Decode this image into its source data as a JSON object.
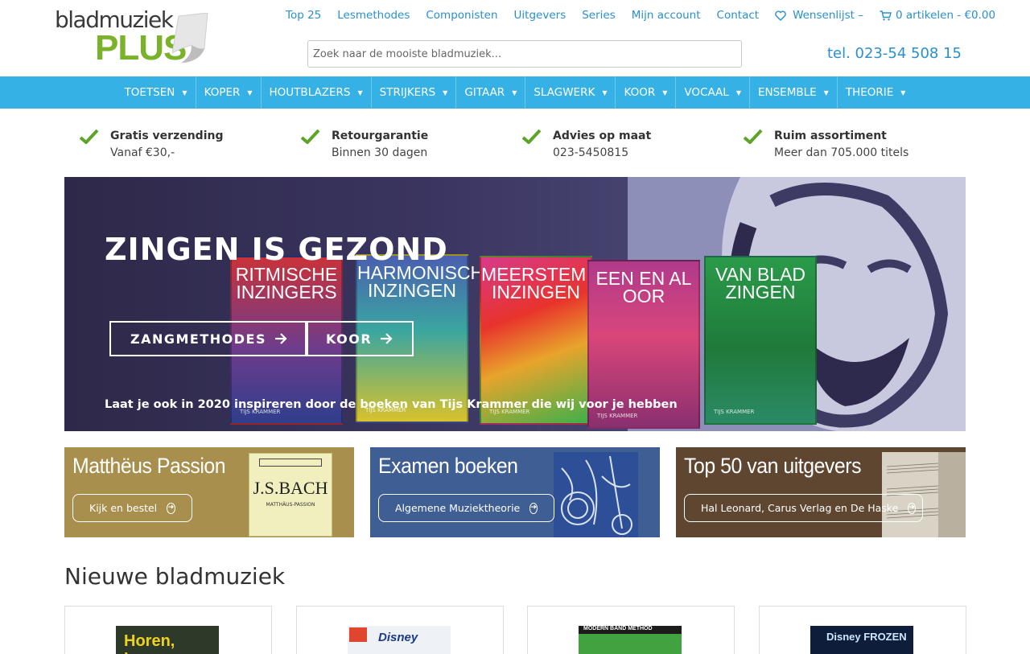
{
  "logo": {
    "top": "bladmuziek",
    "bottom": "PLUS"
  },
  "topnav": {
    "items": [
      "Top 25",
      "Lesmethodes",
      "Componisten",
      "Uitgevers",
      "Series",
      "Mijn account",
      "Contact"
    ],
    "wishlist": "Wensenlijst –",
    "cart": "0 artikelen - €0.00"
  },
  "search": {
    "placeholder": "Zoek naar de mooiste bladmuziek..."
  },
  "phone": "tel. 023-54 508 15",
  "categories": [
    "TOETSEN",
    "KOPER",
    "HOUTBLAZERS",
    "STRIJKERS",
    "GITAAR",
    "SLAGWERK",
    "KOOR",
    "VOCAAL",
    "ENSEMBLE",
    "THEORIE"
  ],
  "usps": [
    {
      "title": "Gratis verzending",
      "sub": "Vanaf €30,-"
    },
    {
      "title": "Retourgarantie",
      "sub": "Binnen 30 dagen"
    },
    {
      "title": "Advies op maat",
      "sub": "023-5450815"
    },
    {
      "title": "Ruim assortiment",
      "sub": "Meer dan 705.000 titels"
    }
  ],
  "hero": {
    "title": "ZINGEN IS GEZOND",
    "buttons": [
      "ZANGMETHODES",
      "KOOR"
    ],
    "tagline": "Laat je ook in 2020 inspireren door de boeken van Tijs Krammer die wij voor je hebben",
    "books": [
      {
        "title": "RITMISCHE INZINGERS",
        "author": "TIJS KRAMMER"
      },
      {
        "title": "HARMONISCH INZINGEN",
        "author": "TIJS KRAMMER"
      },
      {
        "title": "MEERSTEMMIG INZINGEN",
        "author": "TIJS KRAMMER"
      },
      {
        "title": "EEN EN AL OOR",
        "author": "TIJS KRAMMER"
      },
      {
        "title": "VAN BLAD ZINGEN",
        "author": "TIJS KRAMMER"
      }
    ]
  },
  "tiles": [
    {
      "title": "Matthëus Passion",
      "button": "Kijk en bestel",
      "cover_title": "J.S.BACH",
      "cover_sub": "MATTHÄUS-PASSION"
    },
    {
      "title": "Examen boeken",
      "button": "Algemene Muziektheorie"
    },
    {
      "title": "Top 50 van uitgevers",
      "button": "Hal Leonard, Carus Verlag en De Haske"
    }
  ],
  "new_section": {
    "title": "Nieuwe bladmuziek",
    "covers": [
      "Horen, lezen",
      "Disney",
      "MODERN BAND METHOD",
      "Disney FROZEN"
    ]
  },
  "colors": {
    "accent_blue": "#36b1e5",
    "link_blue": "#2a8fcf",
    "brand_green": "#7ab32b",
    "tile_gold": "#a88f4d",
    "tile_blue": "#3f5e93",
    "tile_brown": "#5e4630"
  }
}
